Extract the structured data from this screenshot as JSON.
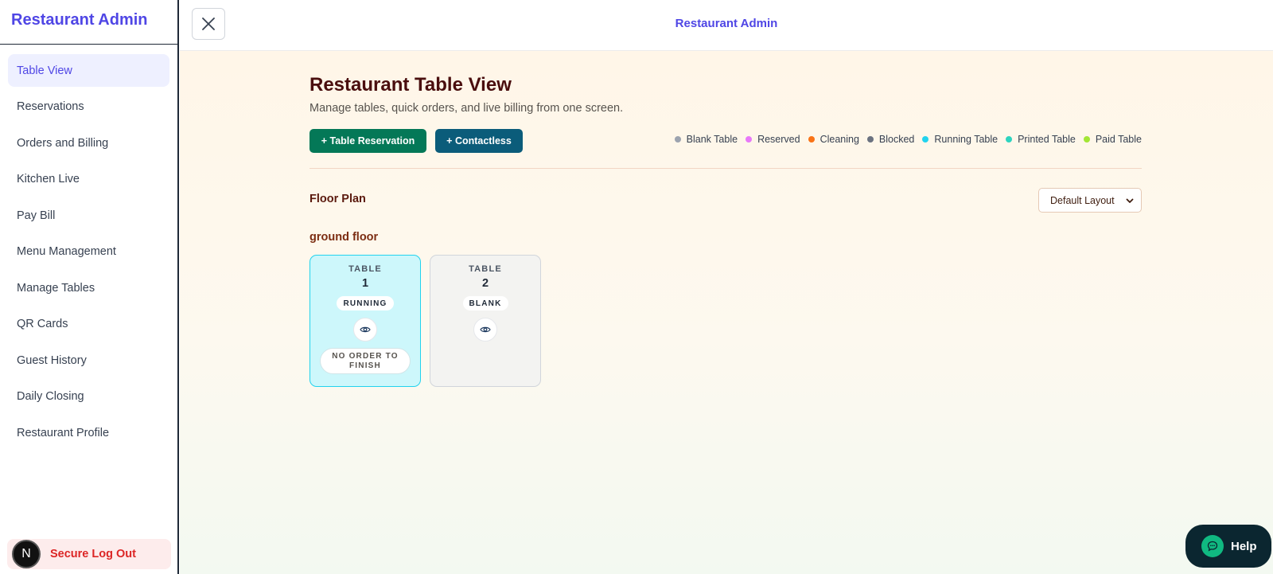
{
  "sidebar": {
    "brand": "Restaurant Admin",
    "items": [
      {
        "label": "Table View",
        "active": true
      },
      {
        "label": "Reservations"
      },
      {
        "label": "Orders and Billing"
      },
      {
        "label": "Kitchen Live"
      },
      {
        "label": "Pay Bill"
      },
      {
        "label": "Menu Management"
      },
      {
        "label": "Manage Tables"
      },
      {
        "label": "QR Cards"
      },
      {
        "label": "Guest History"
      },
      {
        "label": "Daily Closing"
      },
      {
        "label": "Restaurant Profile"
      }
    ],
    "avatar_initial": "N",
    "logout_label": "Secure Log Out"
  },
  "topbar": {
    "close_icon": "close-icon",
    "title": "Restaurant Admin"
  },
  "main": {
    "title": "Restaurant Table View",
    "subtitle": "Manage tables, quick orders, and live billing from one screen.",
    "reservation_button": "+ Table Reservation",
    "contactless_button": "+ Contactless",
    "legend": [
      {
        "label": "Blank Table",
        "color": "#9ca3af"
      },
      {
        "label": "Reserved",
        "color": "#e879f9"
      },
      {
        "label": "Cleaning",
        "color": "#f97316"
      },
      {
        "label": "Blocked",
        "color": "#6b7280"
      },
      {
        "label": "Running Table",
        "color": "#22d3ee"
      },
      {
        "label": "Printed Table",
        "color": "#2dd4bf"
      },
      {
        "label": "Paid Table",
        "color": "#a3e635"
      }
    ],
    "floor_plan_label": "Floor Plan",
    "layout_select": {
      "selected": "Default Layout"
    },
    "floor_name": "ground floor",
    "tables": [
      {
        "label": "TABLE",
        "number": "1",
        "status": "RUNNING",
        "action": "NO ORDER TO FINISH"
      },
      {
        "label": "TABLE",
        "number": "2",
        "status": "BLANK"
      }
    ]
  },
  "help": {
    "label": "Help",
    "icon": "chat-icon"
  }
}
